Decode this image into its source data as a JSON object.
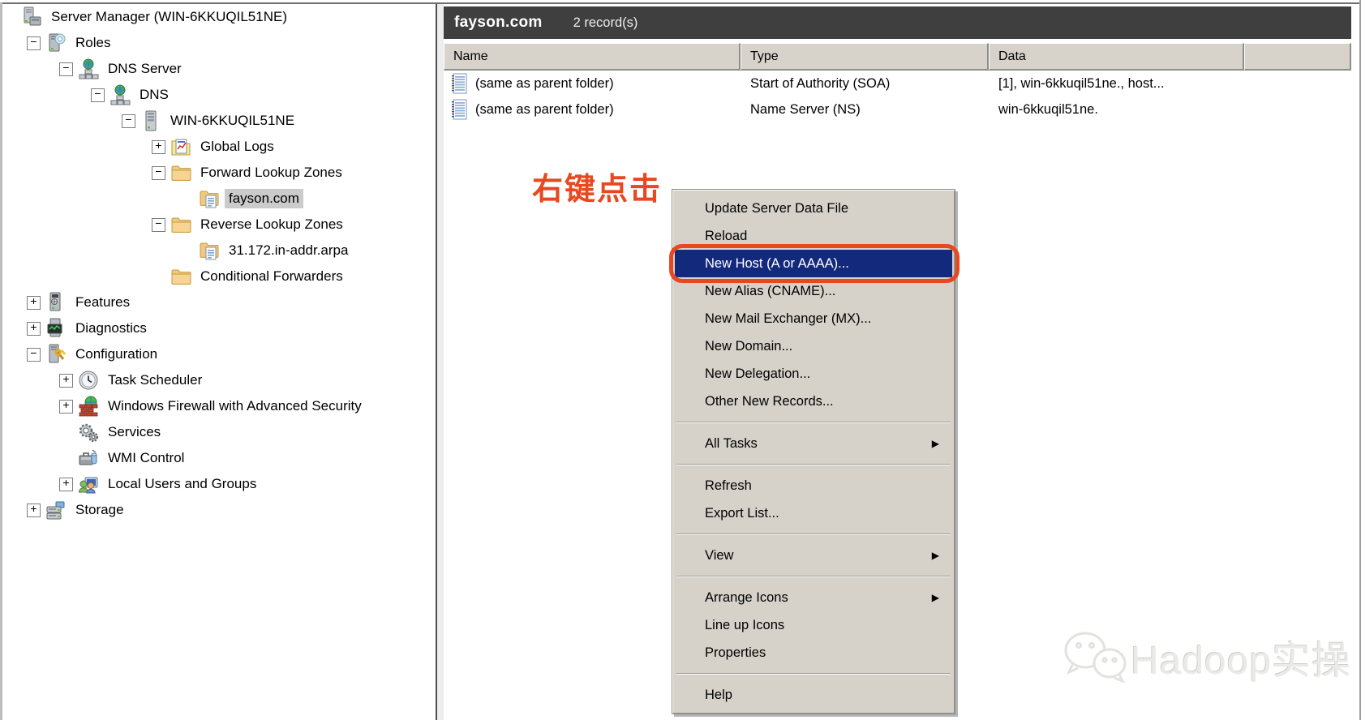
{
  "tree": {
    "items": [
      {
        "label": "Server Manager (WIN-6KKUQIL51NE)",
        "level": 0,
        "expander": null,
        "icon": "server-manager-icon"
      },
      {
        "label": "Roles",
        "level": 1,
        "expander": "minus",
        "icon": "roles-icon"
      },
      {
        "label": "DNS Server",
        "level": 2,
        "expander": "minus",
        "icon": "dns-icon"
      },
      {
        "label": "DNS",
        "level": 3,
        "expander": "minus",
        "icon": "dns-icon"
      },
      {
        "label": "WIN-6KKUQIL51NE",
        "level": 4,
        "expander": "minus",
        "icon": "server-icon"
      },
      {
        "label": "Global Logs",
        "level": 5,
        "expander": "plus",
        "icon": "global-logs-icon"
      },
      {
        "label": "Forward Lookup Zones",
        "level": 5,
        "expander": "minus",
        "icon": "folder-icon"
      },
      {
        "label": "fayson.com",
        "level": 6,
        "expander": null,
        "icon": "zone-icon",
        "selected": true
      },
      {
        "label": "Reverse Lookup Zones",
        "level": 5,
        "expander": "minus",
        "icon": "folder-icon"
      },
      {
        "label": "31.172.in-addr.arpa",
        "level": 6,
        "expander": null,
        "icon": "zone-icon"
      },
      {
        "label": "Conditional Forwarders",
        "level": 5,
        "expander": null,
        "icon": "folder-icon"
      },
      {
        "label": "Features",
        "level": 1,
        "expander": "plus",
        "icon": "features-icon"
      },
      {
        "label": "Diagnostics",
        "level": 1,
        "expander": "plus",
        "icon": "diagnostics-icon"
      },
      {
        "label": "Configuration",
        "level": 1,
        "expander": "minus",
        "icon": "configuration-icon"
      },
      {
        "label": "Task Scheduler",
        "level": 2,
        "expander": "plus",
        "icon": "task-scheduler-icon"
      },
      {
        "label": "Windows Firewall with Advanced Security",
        "level": 2,
        "expander": "plus",
        "icon": "firewall-icon"
      },
      {
        "label": "Services",
        "level": 2,
        "expander": null,
        "icon": "services-icon"
      },
      {
        "label": "WMI Control",
        "level": 2,
        "expander": null,
        "icon": "wmi-icon"
      },
      {
        "label": "Local Users and Groups",
        "level": 2,
        "expander": "plus",
        "icon": "users-icon"
      },
      {
        "label": "Storage",
        "level": 1,
        "expander": "plus",
        "icon": "storage-icon"
      }
    ]
  },
  "zone_bar": {
    "zone": "fayson.com",
    "records": "2 record(s)"
  },
  "record_list": {
    "columns": [
      "Name",
      "Type",
      "Data"
    ],
    "rows": [
      {
        "name": "(same as parent folder)",
        "type": "Start of Authority (SOA)",
        "data": "[1], win-6kkuqil51ne., host...",
        "icon": "record-icon"
      },
      {
        "name": "(same as parent folder)",
        "type": "Name Server (NS)",
        "data": "win-6kkuqil51ne.",
        "icon": "record-icon"
      }
    ]
  },
  "annotation": {
    "label": "右键点击"
  },
  "context_menu": {
    "items": [
      {
        "type": "item",
        "label": "Update Server Data File"
      },
      {
        "type": "item",
        "label": "Reload"
      },
      {
        "type": "item",
        "label": "New Host (A or AAAA)...",
        "highlighted": true
      },
      {
        "type": "item",
        "label": "New Alias (CNAME)..."
      },
      {
        "type": "item",
        "label": "New Mail Exchanger (MX)..."
      },
      {
        "type": "item",
        "label": "New Domain..."
      },
      {
        "type": "item",
        "label": "New Delegation..."
      },
      {
        "type": "item",
        "label": "Other New Records..."
      },
      {
        "type": "separator"
      },
      {
        "type": "item",
        "label": "All Tasks",
        "submenu": true
      },
      {
        "type": "separator"
      },
      {
        "type": "item",
        "label": "Refresh"
      },
      {
        "type": "item",
        "label": "Export List..."
      },
      {
        "type": "separator"
      },
      {
        "type": "item",
        "label": "View",
        "submenu": true
      },
      {
        "type": "separator"
      },
      {
        "type": "item",
        "label": "Arrange Icons",
        "submenu": true
      },
      {
        "type": "item",
        "label": "Line up Icons"
      },
      {
        "type": "item",
        "label": "Properties"
      },
      {
        "type": "separator"
      },
      {
        "type": "item",
        "label": "Help"
      }
    ]
  },
  "watermark": {
    "label": "Hadoop实操",
    "icon": "wechat-icon"
  },
  "colors": {
    "menu_highlight": "#132a7c",
    "annotation": "#e8481f",
    "zone_bar_bg": "#3f3f3f",
    "tree_selection_bg": "#cbcbcb"
  }
}
